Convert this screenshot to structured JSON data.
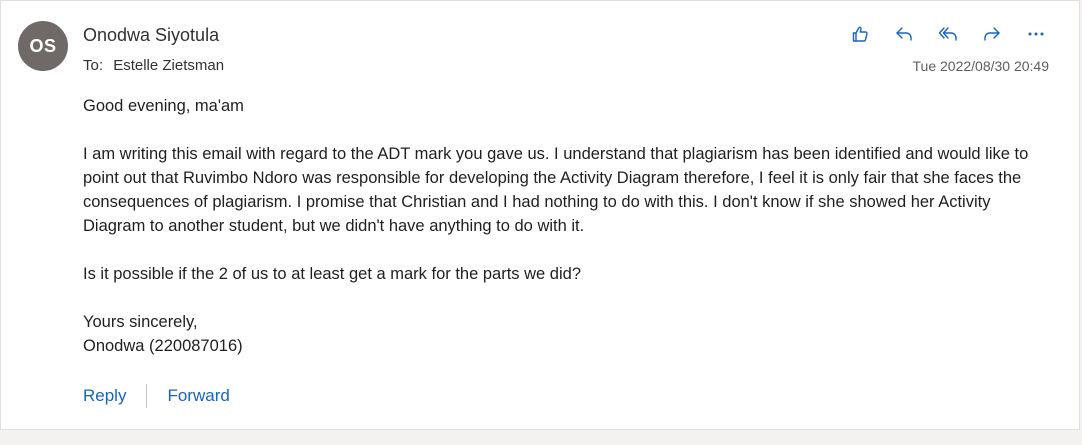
{
  "sender": {
    "initials": "OS",
    "name": "Onodwa Siyotula"
  },
  "recipient": {
    "label": "To:",
    "name": "Estelle Zietsman"
  },
  "timestamp": "Tue 2022/08/30 20:49",
  "actions": [
    {
      "icon": "thumbs-up-icon"
    },
    {
      "icon": "reply-icon"
    },
    {
      "icon": "reply-all-icon"
    },
    {
      "icon": "forward-icon"
    },
    {
      "icon": "more-icon"
    }
  ],
  "message": {
    "greeting": "Good evening, ma'am",
    "paragraph1": "I am writing this email with regard to the ADT mark you gave us. I understand that plagiarism has been identified and would like to point out that Ruvimbo Ndoro was responsible for developing the Activity Diagram therefore, I feel it is only fair that she faces the consequences of plagiarism. I promise that Christian and I had nothing to do with this. I don't know if she showed her Activity Diagram to another student, but we didn't have anything to do with it.",
    "paragraph2": "Is it possible if the 2 of us to at least get a mark for the parts we did?",
    "closing": "Yours sincerely,",
    "signature": "Onodwa (220087016)"
  },
  "footer": {
    "reply_label": "Reply",
    "forward_label": "Forward"
  },
  "colors": {
    "accent": "#1565c0",
    "avatar_bg": "#6f6a67",
    "icon": "#1565c0"
  }
}
